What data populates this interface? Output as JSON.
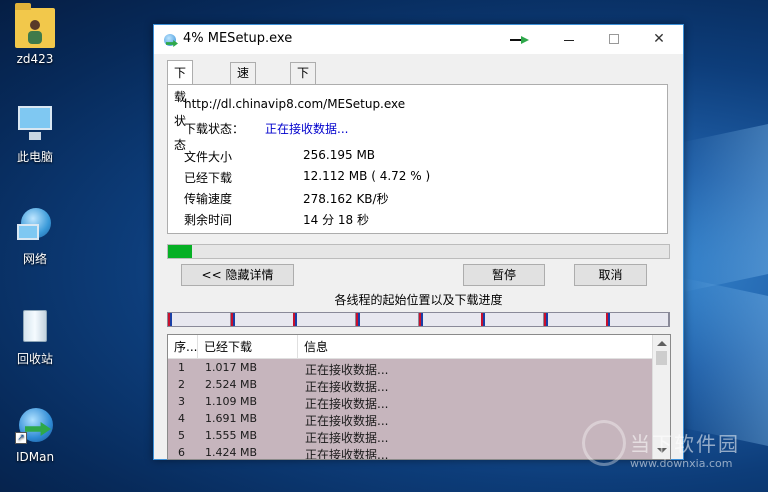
{
  "desktop": {
    "icons": [
      {
        "label": "zd423"
      },
      {
        "label": "此电脑"
      },
      {
        "label": "网络"
      },
      {
        "label": "回收站"
      },
      {
        "label": "IDMan"
      }
    ]
  },
  "window": {
    "title": "4% MESetup.exe",
    "tabs": [
      {
        "label": "下载状态",
        "active": true
      },
      {
        "label": "速度限制",
        "active": false
      },
      {
        "label": "下载完成选项",
        "active": false
      }
    ],
    "url": "http://dl.chinavip8.com/MESetup.exe",
    "status_label": "下载状态：",
    "status_value": "正在接收数据...",
    "info": [
      {
        "key": "文件大小",
        "value": "256.195  MB"
      },
      {
        "key": "已经下载",
        "value": "12.112  MB  ( 4.72 % )"
      },
      {
        "key": "传输速度",
        "value": "278.162  KB/秒"
      },
      {
        "key": "剩余时间",
        "value": "14 分 18 秒"
      }
    ],
    "progress_fraction": 0.0472,
    "buttons": {
      "hide_details": "<< 隐藏详情",
      "pause": "暂停",
      "cancel": "取消"
    },
    "threads_label": "各线程的起始位置以及下载进度",
    "thread_count": 8,
    "list": {
      "headers": [
        "序...",
        "已经下载",
        "信息"
      ],
      "rows": [
        {
          "idx": "1",
          "downloaded": "1.017  MB",
          "info": "正在接收数据..."
        },
        {
          "idx": "2",
          "downloaded": "2.524  MB",
          "info": "正在接收数据..."
        },
        {
          "idx": "3",
          "downloaded": "1.109  MB",
          "info": "正在接收数据..."
        },
        {
          "idx": "4",
          "downloaded": "1.691  MB",
          "info": "正在接收数据..."
        },
        {
          "idx": "5",
          "downloaded": "1.555  MB",
          "info": "正在接收数据..."
        },
        {
          "idx": "6",
          "downloaded": "1.424  MB",
          "info": "正在接收数据..."
        }
      ]
    }
  },
  "watermark": {
    "text": "当下软件园",
    "url": "www.downxia.com"
  },
  "colors": {
    "progress": "#06b025",
    "status_link": "#0000cc",
    "list_bg": "#c6b5bd"
  }
}
